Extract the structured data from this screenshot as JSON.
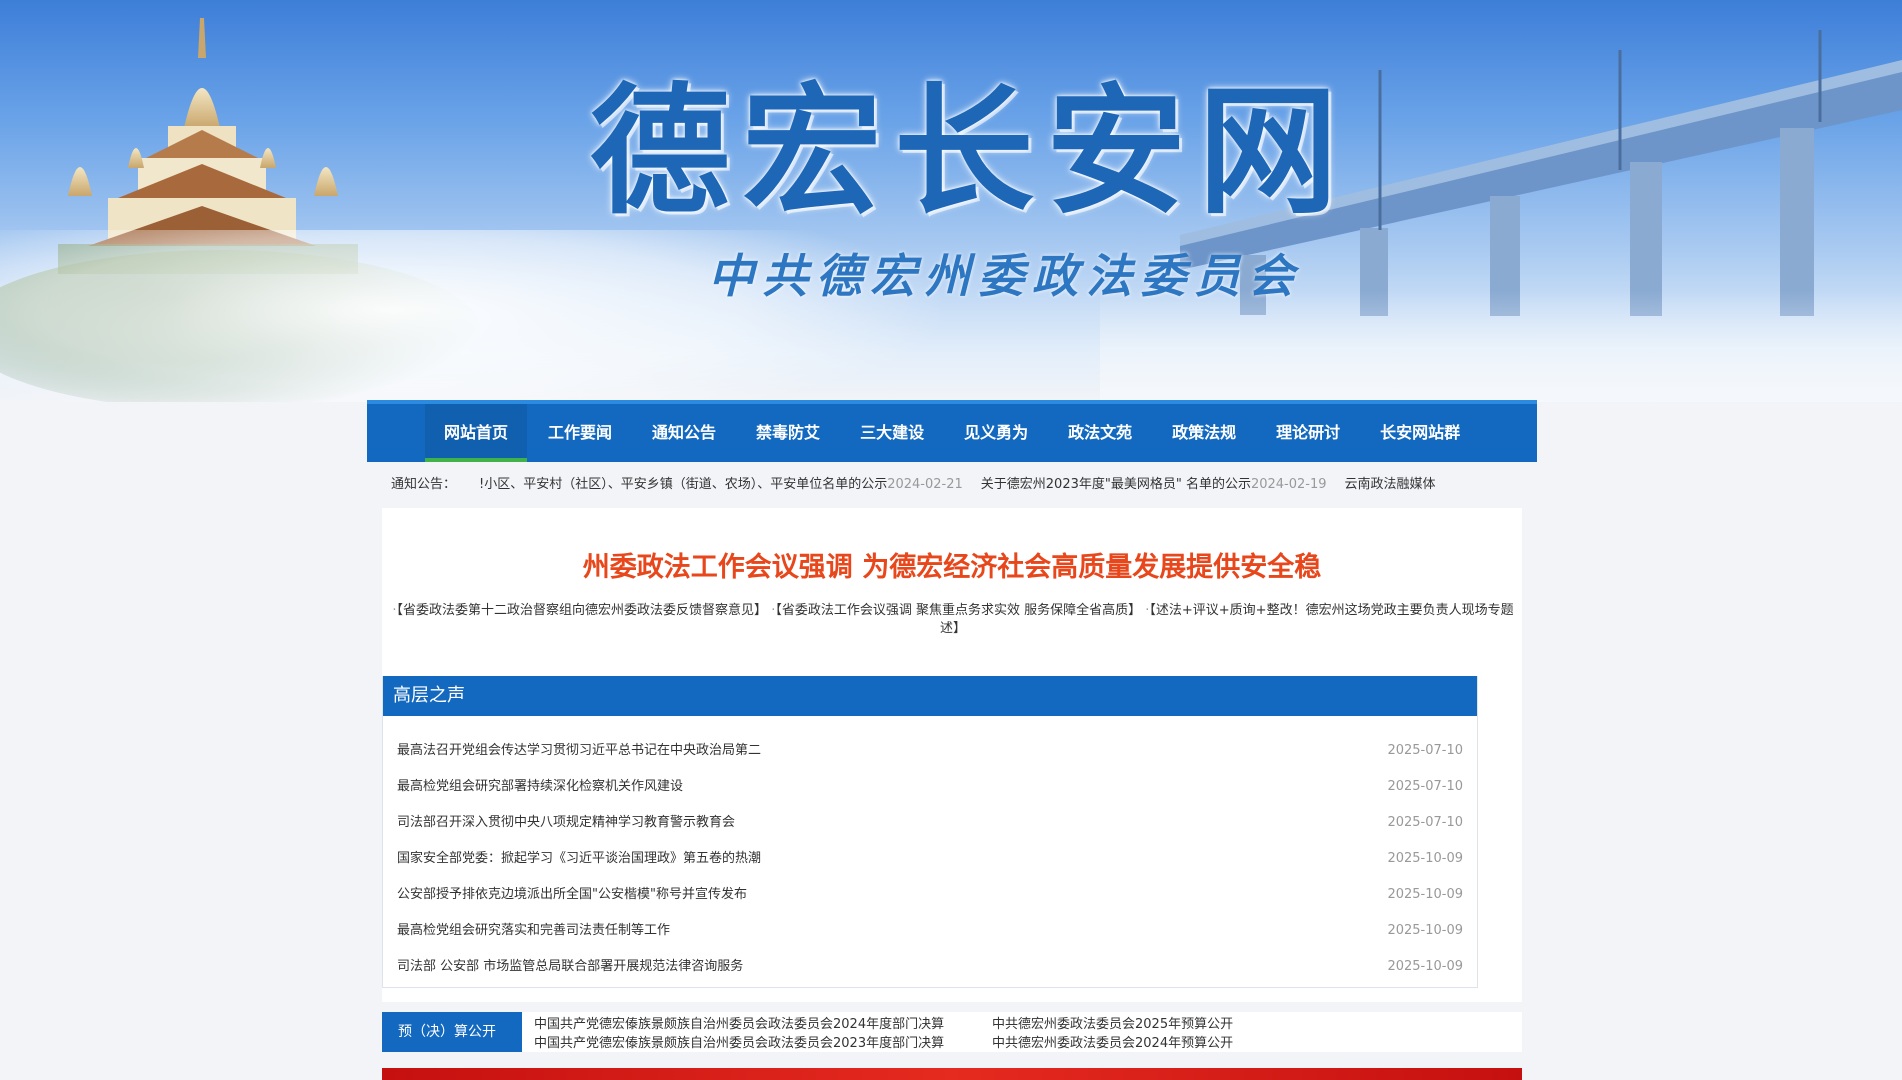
{
  "banner": {
    "title": "德宏长安网",
    "subtitle": "中共德宏州委政法委员会"
  },
  "nav": {
    "items": [
      {
        "label": "网站首页",
        "active": true
      },
      {
        "label": "工作要闻"
      },
      {
        "label": "通知公告"
      },
      {
        "label": "禁毒防艾"
      },
      {
        "label": "三大建设"
      },
      {
        "label": "见义勇为"
      },
      {
        "label": "政法文苑"
      },
      {
        "label": "政策法规"
      },
      {
        "label": "理论研讨"
      },
      {
        "label": "长安网站群"
      }
    ]
  },
  "notice": {
    "label": "通知公告：",
    "items": [
      {
        "text": "!小区、平安村（社区）、平安乡镇（街道、农场）、平安单位名单的公示",
        "date": "2024-02-21"
      },
      {
        "text": "关于德宏州2023年度\"最美网格员\" 名单的公示",
        "date": "2024-02-19"
      },
      {
        "text": "云南政法融媒体",
        "date": ""
      }
    ]
  },
  "headline": "州委政法工作会议强调 为德宏经济社会高质量发展提供安全稳",
  "related": {
    "items": [
      "【省委政法委第十二政治督察组向德宏州委政法委反馈督察意见】",
      "【省委政法工作会议强调 聚焦重点务求实效 服务保障全省高质】",
      "【述法+评议+质询+整改！德宏州这场党政主要负责人现场专题述】"
    ]
  },
  "panel": {
    "title": "高层之声",
    "items": [
      {
        "title": "最高法召开党组会传达学习贯彻习近平总书记在中央政治局第二",
        "date": "2025-07-10"
      },
      {
        "title": "最高检党组会研究部署持续深化检察机关作风建设",
        "date": "2025-07-10"
      },
      {
        "title": "司法部召开深入贯彻中央八项规定精神学习教育警示教育会",
        "date": "2025-07-10"
      },
      {
        "title": "国家安全部党委：掀起学习《习近平谈治国理政》第五卷的热潮",
        "date": "2025-10-09"
      },
      {
        "title": "公安部授予排依克边境派出所全国\"公安楷模\"称号并宣传发布",
        "date": "2025-10-09"
      },
      {
        "title": "最高检党组会研究落实和完善司法责任制等工作",
        "date": "2025-10-09"
      },
      {
        "title": "司法部 公安部 市场监管总局联合部署开展规范法律咨询服务",
        "date": "2025-10-09"
      }
    ]
  },
  "budget": {
    "tag": "预（决）算公开",
    "col1": [
      "中国共产党德宏傣族景颇族自治州委员会政法委员会2024年度部门决算",
      "中国共产党德宏傣族景颇族自治州委员会政法委员会2023年度部门决算"
    ],
    "col2": [
      "中共德宏州委政法委员会2025年预算公开",
      "中共德宏州委政法委员会2024年预算公开"
    ]
  },
  "colors": {
    "brand_blue": "#1369bf",
    "accent_green": "#3fb24a",
    "headline_red": "#e8461b",
    "title_blue": "#1e67b7"
  }
}
